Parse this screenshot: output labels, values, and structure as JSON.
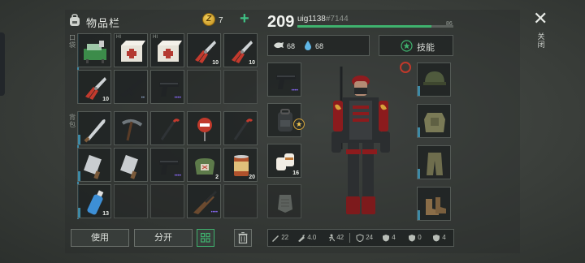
{
  "inventory": {
    "title": "物品栏",
    "coins": "7",
    "plus": "+",
    "sections": {
      "pockets": "口袋",
      "backpack": "背包"
    },
    "pocket_slots": [
      {
        "name": "workbench-kit",
        "qty": "",
        "tag": "",
        "dots": ""
      },
      {
        "name": "medical-box",
        "qty": "",
        "tag": "HI",
        "dots": ""
      },
      {
        "name": "medical-box",
        "qty": "",
        "tag": "HI",
        "dots": ""
      },
      {
        "name": "pliers",
        "qty": "10",
        "tag": "",
        "dots": ""
      },
      {
        "name": "pliers",
        "qty": "10",
        "tag": "",
        "dots": ""
      },
      {
        "name": "pliers",
        "qty": "10",
        "tag": "",
        "dots": ""
      },
      {
        "name": "rifle",
        "qty": "",
        "tag": "",
        "dots": "••"
      },
      {
        "name": "pistol",
        "qty": "",
        "tag": "",
        "dots": "••••"
      },
      {
        "name": "empty",
        "qty": "",
        "tag": "",
        "dots": ""
      },
      {
        "name": "empty",
        "qty": "",
        "tag": "",
        "dots": ""
      }
    ],
    "backpack_slots": [
      {
        "name": "machete",
        "qty": "",
        "tag": "",
        "dots": ""
      },
      {
        "name": "pickaxe",
        "qty": "",
        "tag": "",
        "dots": ""
      },
      {
        "name": "crowbar",
        "qty": "",
        "tag": "",
        "dots": ""
      },
      {
        "name": "stop-sign",
        "qty": "",
        "tag": "",
        "dots": ""
      },
      {
        "name": "crowbar",
        "qty": "",
        "tag": "",
        "dots": ""
      },
      {
        "name": "cleaver",
        "qty": "",
        "tag": "",
        "dots": ""
      },
      {
        "name": "cleaver",
        "qty": "",
        "tag": "",
        "dots": ""
      },
      {
        "name": "pistol",
        "qty": "",
        "tag": "",
        "dots": "••••"
      },
      {
        "name": "herb-bag",
        "qty": "2",
        "tag": "",
        "dots": ""
      },
      {
        "name": "canned-food",
        "qty": "20",
        "tag": "",
        "dots": ""
      },
      {
        "name": "water-bottle",
        "qty": "13",
        "tag": "",
        "dots": ""
      },
      {
        "name": "empty",
        "qty": "",
        "tag": "",
        "dots": ""
      },
      {
        "name": "empty",
        "qty": "",
        "tag": "",
        "dots": ""
      },
      {
        "name": "shotgun",
        "qty": "",
        "tag": "",
        "dots": "••••"
      },
      {
        "name": "empty",
        "qty": "",
        "tag": "",
        "dots": ""
      }
    ],
    "buttons": {
      "use": "使用",
      "split": "分开"
    }
  },
  "character": {
    "level": "209",
    "username": "uig1138",
    "user_id": "#7144",
    "xp_max": "86",
    "xp_fraction": 0.86,
    "hunger": "68",
    "thirst": "68",
    "skill_label": "技能",
    "weapon_slots": [
      {
        "name": "pistol",
        "qty": "",
        "dots": "••••"
      },
      {
        "name": "backpack",
        "qty": "",
        "dots": ""
      },
      {
        "name": "bandages",
        "qty": "16",
        "dots": ""
      },
      {
        "name": "empty",
        "qty": "",
        "dots": ""
      }
    ],
    "armor_slots": [
      "helmet",
      "body-armor",
      "pants",
      "boots"
    ],
    "stats": [
      {
        "icon": "melee-icon",
        "value": "22"
      },
      {
        "icon": "ranged-icon",
        "value": "4.0"
      },
      {
        "icon": "speed-icon",
        "value": "42"
      },
      {
        "icon": "armor-icon",
        "value": "24"
      },
      {
        "icon": "cold-icon",
        "value": "4"
      },
      {
        "icon": "rad-icon",
        "value": "0"
      },
      {
        "icon": "bio-icon",
        "value": "4"
      }
    ]
  },
  "close_label": "关闭",
  "colors": {
    "accent_green": "#3fb26e",
    "slot_bar": "#3d8aa6",
    "rare_purple": "#8d6bff"
  }
}
